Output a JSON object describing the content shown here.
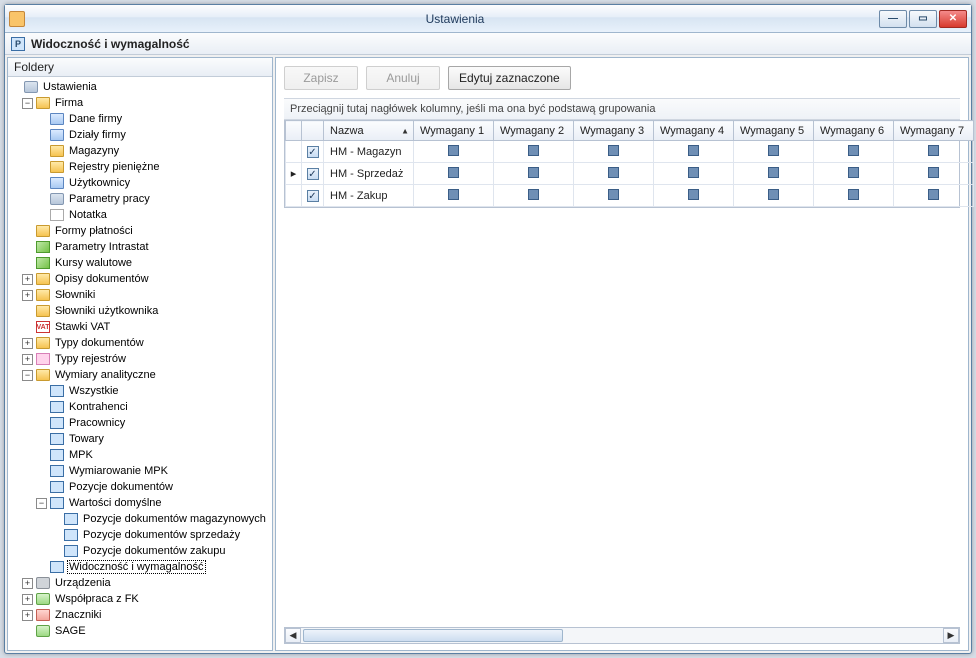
{
  "window": {
    "title": "Ustawienia"
  },
  "subheader": {
    "title": "Widoczność i wymagalność"
  },
  "sidebar": {
    "title": "Foldery"
  },
  "tree": {
    "root": "Ustawienia",
    "firma": "Firma",
    "firma_children": {
      "dane_firmy": "Dane firmy",
      "dzialy_firmy": "Działy firmy",
      "magazyny": "Magazyny",
      "rejestry_pieniezne": "Rejestry pieniężne",
      "uzytkownicy": "Użytkownicy",
      "parametry_pracy": "Parametry pracy",
      "notatka": "Notatka"
    },
    "formy_platnosci": "Formy płatności",
    "parametry_intrastat": "Parametry Intrastat",
    "kursy_walutowe": "Kursy walutowe",
    "opisy_dokumentow": "Opisy dokumentów",
    "slowniki": "Słowniki",
    "slowniki_uzytkownika": "Słowniki użytkownika",
    "stawki_vat": "Stawki VAT",
    "typy_dokumentow": "Typy dokumentów",
    "typy_rejestrow": "Typy rejestrów",
    "wymiary_analityczne": "Wymiary analityczne",
    "wymiary": {
      "wszystkie": "Wszystkie",
      "kontrahenci": "Kontrahenci",
      "pracownicy": "Pracownicy",
      "towary": "Towary",
      "mpk": "MPK",
      "wymiarowanie_mpk": "Wymiarowanie MPK",
      "pozycje_dokumentow": "Pozycje dokumentów",
      "wartosci_domyslne": "Wartości domyślne",
      "poz_mag": "Pozycje dokumentów magazynowych",
      "poz_sprz": "Pozycje dokumentów sprzedaży",
      "poz_zak": "Pozycje dokumentów zakupu",
      "widocznosc": "Widoczność i wymagalność"
    },
    "urzadzenia": "Urządzenia",
    "wspolpraca_fk": "Współpraca z FK",
    "znaczniki": "Znaczniki",
    "sage": "SAGE"
  },
  "toolbar": {
    "save": "Zapisz",
    "cancel": "Anuluj",
    "edit_selected": "Edytuj zaznaczone"
  },
  "grid": {
    "group_hint": "Przeciągnij tutaj nagłówek kolumny, jeśli ma ona być podstawą grupowania",
    "columns": {
      "nazwa": "Nazwa",
      "w1": "Wymagany 1",
      "w2": "Wymagany 2",
      "w3": "Wymagany 3",
      "w4": "Wymagany 4",
      "w5": "Wymagany 5",
      "w6": "Wymagany 6",
      "w7": "Wymagany 7"
    },
    "rows": [
      {
        "checked": true,
        "active": false,
        "nazwa": "HM - Magazyn"
      },
      {
        "checked": true,
        "active": true,
        "nazwa": "HM - Sprzedaż"
      },
      {
        "checked": true,
        "active": false,
        "nazwa": "HM - Zakup"
      }
    ]
  }
}
